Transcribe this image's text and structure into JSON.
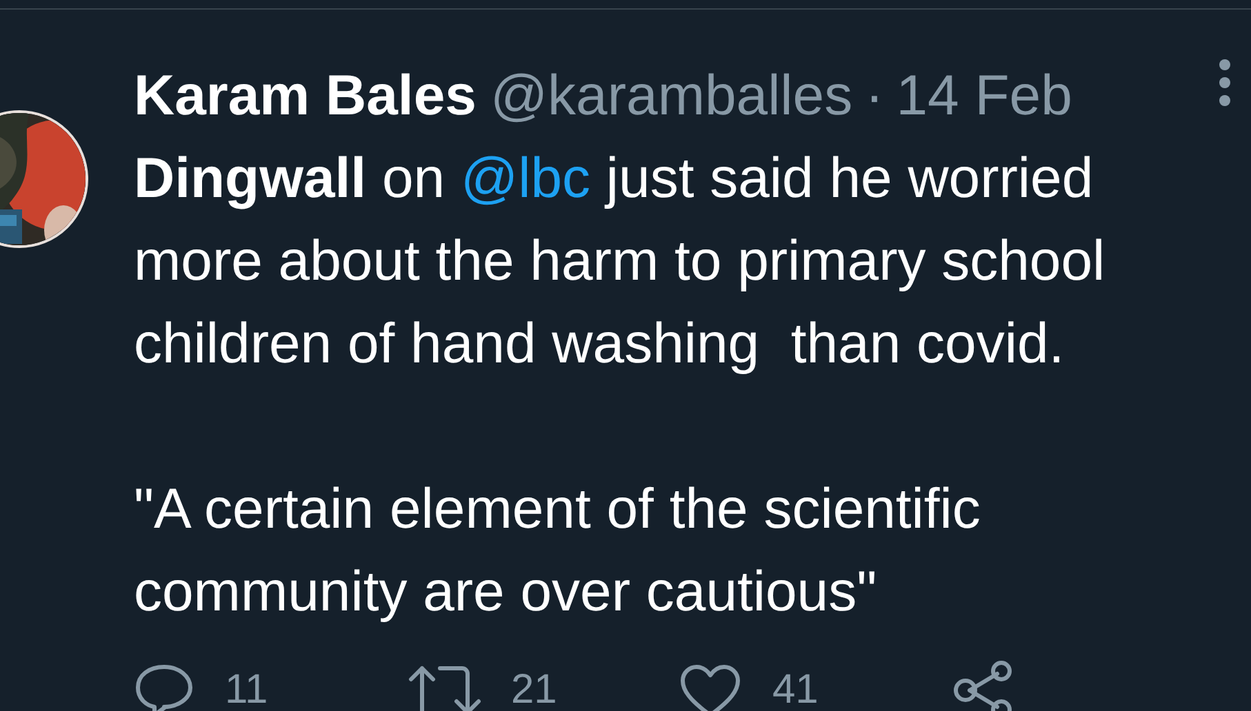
{
  "tweet": {
    "author_name": "Karam Bales",
    "handle": "@karamballes",
    "separator": "·",
    "date": "14 Feb",
    "body": [
      {
        "kind": "text",
        "text": "**Dingwall** on "
      },
      {
        "kind": "mention",
        "text": "@lbc"
      },
      {
        "kind": "text",
        "text": " just said he worried more about the harm to primary school children of hand washing  than covid."
      }
    ],
    "quote": "\"A certain element of the scientific community are over cautious\"",
    "actions": [
      {
        "kind": "reply",
        "count": "11"
      },
      {
        "kind": "retweet",
        "count": "21"
      },
      {
        "kind": "like",
        "count": "41"
      },
      {
        "kind": "share"
      }
    ]
  }
}
